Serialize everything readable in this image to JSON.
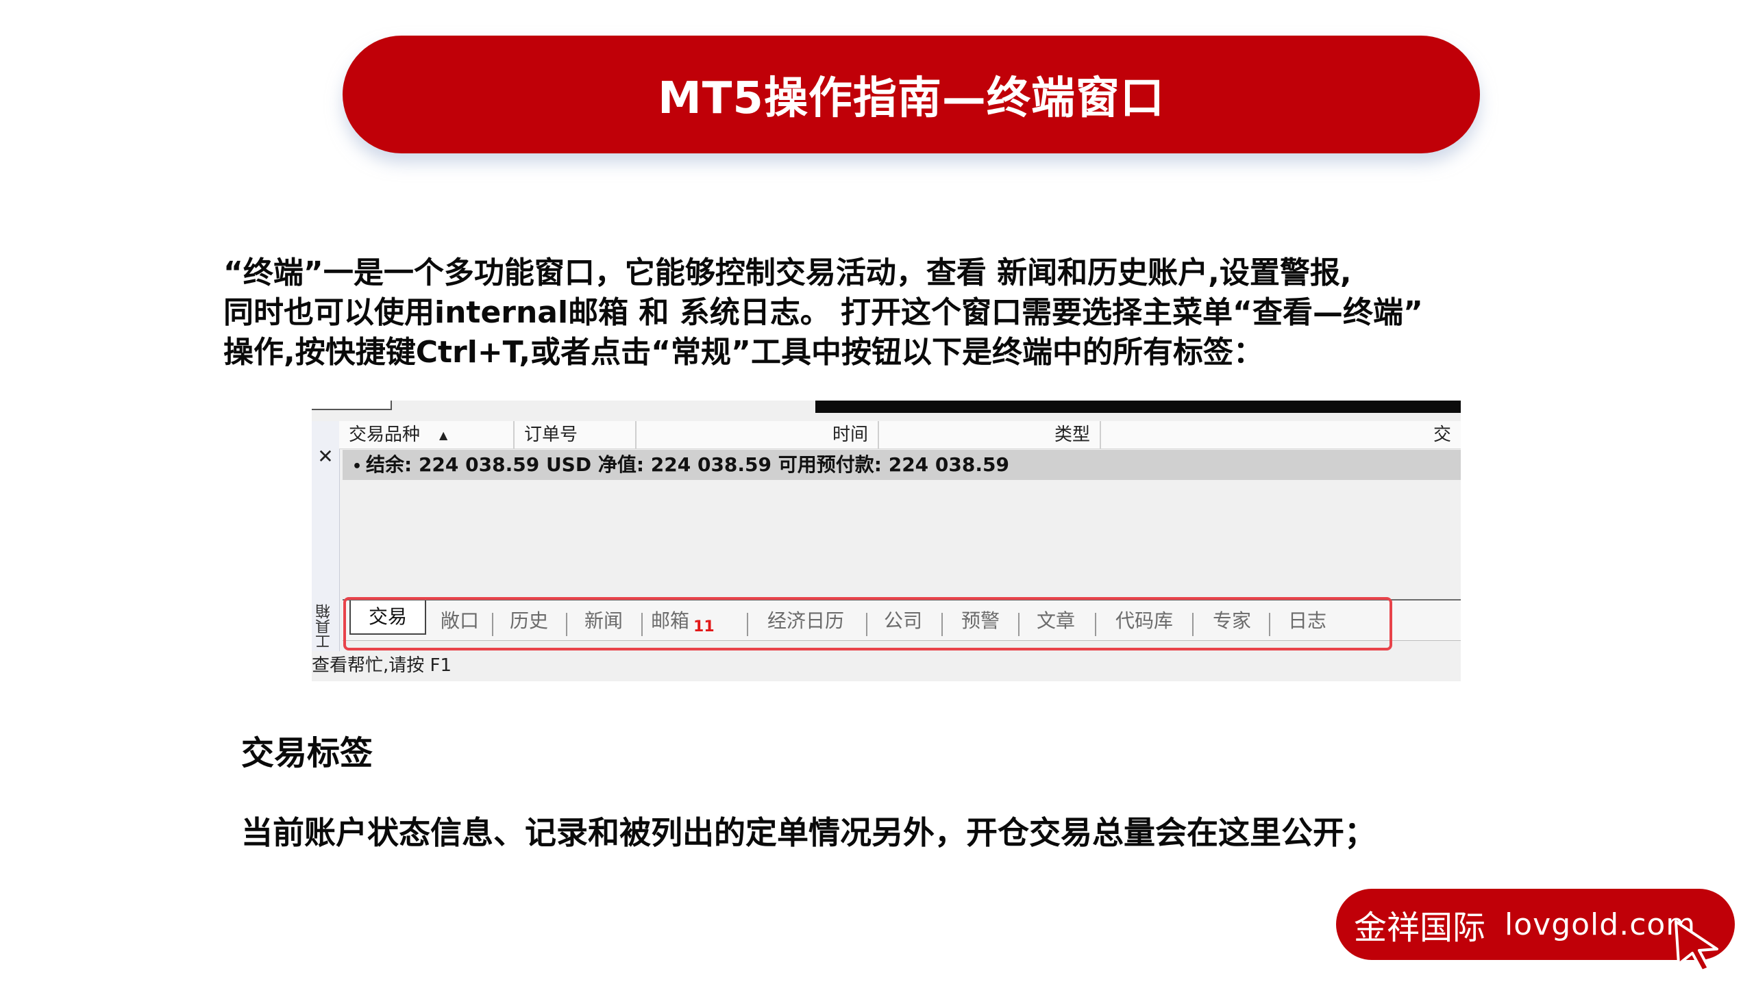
{
  "title": "MT5操作指南—终端窗口",
  "intro": {
    "lines": [
      "“终端”一是一个多功能窗口，它能够控制交易活动，查看 新闻和历史账户,设置警报,",
      "同时也可以使用internal邮箱 和 系统日志。 打开这个窗口需要选择主菜单“查看—终端”",
      "操作,按快捷键Ctrl+T,或者点击“常规”工具中按钮以下是终端中的所有标签："
    ]
  },
  "terminal": {
    "close_glyph": "✕",
    "sidebar_label": "工具箱",
    "columns": [
      "交易品种",
      "订单号",
      "时间",
      "类型",
      "交"
    ],
    "sort_glyph": "▲",
    "balance_row": "结余: 224 038.59 USD  净值: 224 038.59  可用预付款: 224 038.59",
    "bullet": "•",
    "tabs": [
      {
        "label": "交易",
        "active": true
      },
      {
        "label": "敞口"
      },
      {
        "label": "历史"
      },
      {
        "label": "新闻"
      },
      {
        "label": "邮箱",
        "badge": "11"
      },
      {
        "label": "经济日历"
      },
      {
        "label": "公司"
      },
      {
        "label": "预警"
      },
      {
        "label": "文章"
      },
      {
        "label": "代码库"
      },
      {
        "label": "专家"
      },
      {
        "label": "日志"
      }
    ],
    "status_bar": "查看帮忙,请按 F1"
  },
  "section": {
    "heading": "交易标签",
    "text": "当前账户状态信息、记录和被列出的定单情况另外，开仓交易总量会在这里公开；"
  },
  "brand": {
    "name": "金祥国际",
    "url": "lovgold.com"
  },
  "colors": {
    "brand_red": "#c00008",
    "highlight_red": "#e8434a",
    "badge_red": "#e21818"
  },
  "icons": [
    "close-icon",
    "sort-ascending-icon",
    "cursor-pointer-icon"
  ]
}
